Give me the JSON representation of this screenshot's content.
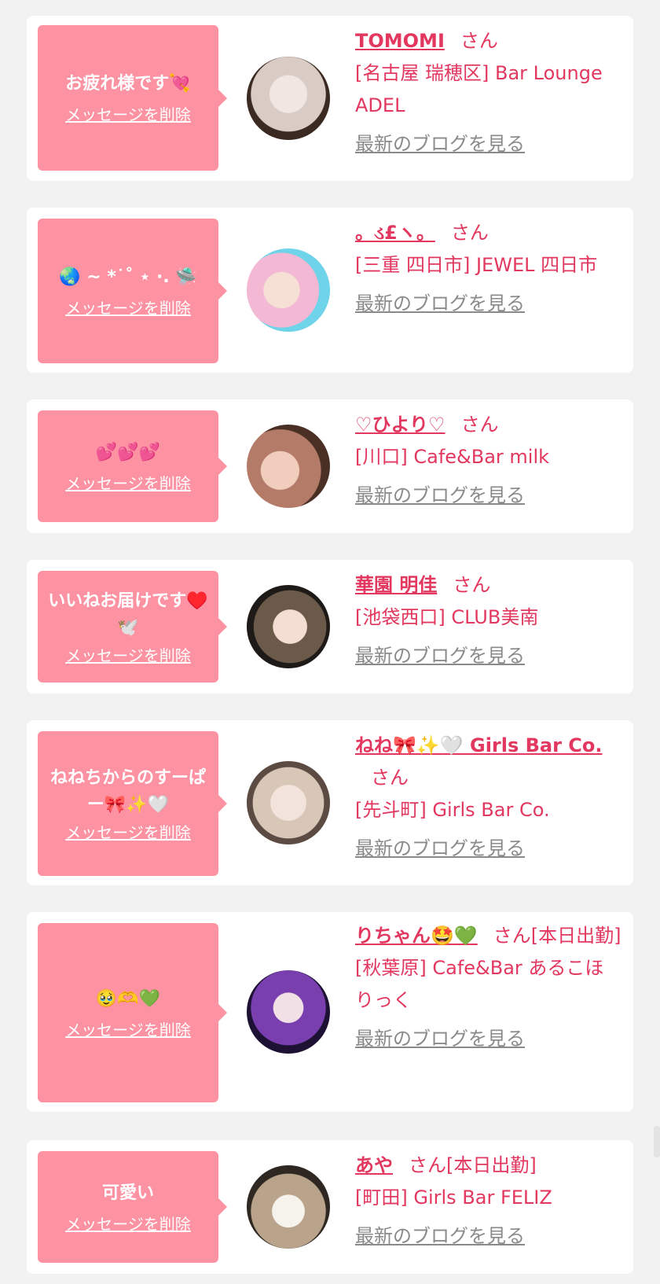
{
  "suffix": "さん",
  "delete_label": "メッセージを削除",
  "blog_label": "最新のブログを見る",
  "cards": [
    {
      "message": "お疲れ様です💘",
      "name": "TOMOMI",
      "name_suffix": "さん",
      "shop": "[名古屋 瑞穂区] Bar Lounge ADEL",
      "avatar_colors": [
        "#d9ccc4",
        "#3a2a22"
      ]
    },
    {
      "message": "🌏 ~ *˙˚ ⋆ ·. 🛸",
      "name": "。ડ£ヽ。",
      "name_suffix": "さん",
      "shop": "[三重 四日市] JEWEL 四日市",
      "avatar_colors": [
        "#f3b8d4",
        "#6fd3ea"
      ]
    },
    {
      "message": "💕💕💕",
      "name": "♡ひより♡",
      "name_suffix": "さん",
      "shop": "[川口] Cafe&Bar milk",
      "avatar_colors": [
        "#b57b69",
        "#4a2f24"
      ]
    },
    {
      "message": "いいねお届けです♥️🕊️",
      "name": "華園 明佳",
      "name_suffix": "さん",
      "shop": "[池袋西口] CLUB美南",
      "avatar_colors": [
        "#6b5a4a",
        "#1e1a18"
      ]
    },
    {
      "message": "ねねちからのすーぱー🎀✨🤍",
      "name": "ねね🎀✨🤍 Girls Bar Co.",
      "name_suffix": "さん",
      "shop": "[先斗町] Girls Bar Co.",
      "avatar_colors": [
        "#d8c6b6",
        "#5b4b42"
      ]
    },
    {
      "message": "🥹🫶💚",
      "name": "りちゃん🤩💚",
      "name_suffix": "さん[本日出勤]",
      "shop": "[秋葉原] Cafe&Bar あるこほりっく",
      "avatar_colors": [
        "#7a3fae",
        "#1d1233"
      ]
    },
    {
      "message": "可愛い",
      "name": "あや",
      "name_suffix": "さん[本日出勤]",
      "shop": "[町田] Girls Bar FELIZ",
      "avatar_colors": [
        "#b9a38a",
        "#2e2722"
      ]
    }
  ]
}
